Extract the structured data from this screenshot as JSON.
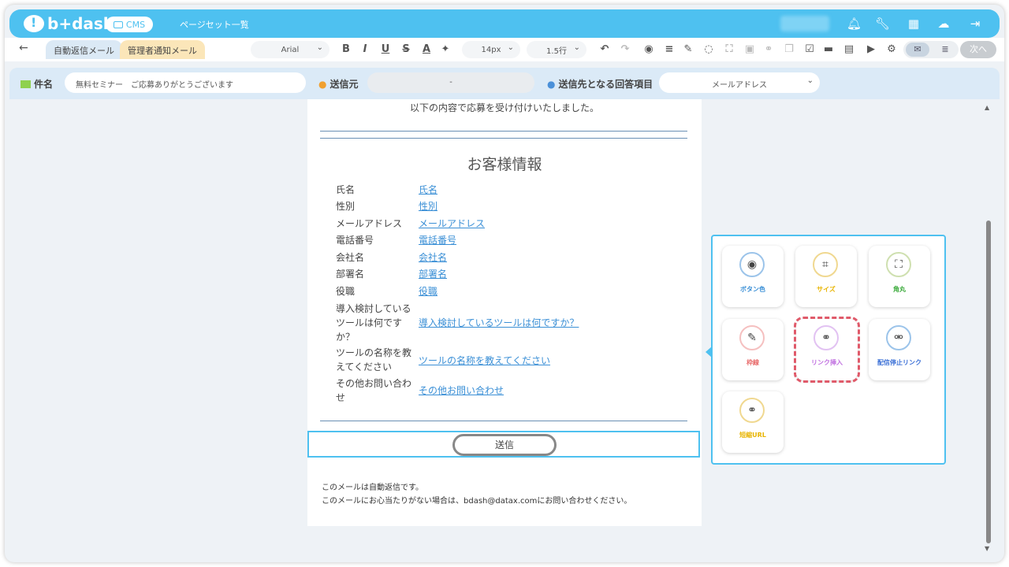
{
  "header": {
    "logo_text": "b+dash",
    "cms_label": "CMS",
    "page_set_label": "ページセット一覧"
  },
  "toolbar": {
    "back_icon": "arrow-left-icon",
    "tabs": [
      {
        "label": "自動返信メール"
      },
      {
        "label": "管理者通知メール"
      }
    ],
    "font_family": "Arial",
    "font_size": "14px",
    "line_height": "1.5行",
    "next_label": "次へ"
  },
  "fields": {
    "subject_label": "件名",
    "subject_value": "無料セミナー　ご応募ありがとうございます",
    "sender_label": "送信元",
    "sender_value": "-",
    "recipient_label": "送信先となる回答項目",
    "recipient_value": "メールアドレス"
  },
  "document": {
    "intro": "以下の内容で応募を受け付けいたしました。",
    "section_title": "お客様情報",
    "rows": [
      {
        "label": "氏名",
        "value": "氏名"
      },
      {
        "label": "性別",
        "value": "性別"
      },
      {
        "label": "メールアドレス",
        "value": "メールアドレス"
      },
      {
        "label": "電話番号",
        "value": "電話番号"
      },
      {
        "label": "会社名",
        "value": "会社名"
      },
      {
        "label": "部署名",
        "value": "部署名"
      },
      {
        "label": "役職",
        "value": "役職"
      },
      {
        "label": "導入検討している\nツールは何です\nか？",
        "value": "導入検討しているツールは何ですか？"
      },
      {
        "label": "ツールの名称を教\nえてください",
        "value": "ツールの名称を教えてください"
      },
      {
        "label": "その他お問い合わ\nせ",
        "value": "その他お問い合わせ"
      }
    ],
    "send_button": "送信",
    "footer_line1": "このメールは自動返信です。",
    "footer_line2": "このメールにお心当たりがない場合は、bdash@datax.comにお問い合わせください。"
  },
  "panel": {
    "tiles": [
      {
        "label": "ボタン色",
        "icon": "palette-icon",
        "color": "#3a8fd6"
      },
      {
        "label": "サイズ",
        "icon": "crop-icon",
        "color": "#e8b400"
      },
      {
        "label": "角丸",
        "icon": "corners-icon",
        "color": "#3aaa3a"
      },
      {
        "label": "枠線",
        "icon": "pen-icon",
        "color": "#e86a6a"
      },
      {
        "label": "リンク挿入",
        "icon": "link-icon",
        "color": "#c070e0"
      },
      {
        "label": "配信停止リンク",
        "icon": "unlink-icon",
        "color": "#3a6fd6"
      },
      {
        "label": "短縮URL",
        "icon": "short-url-icon",
        "color": "#e8b400"
      }
    ]
  }
}
